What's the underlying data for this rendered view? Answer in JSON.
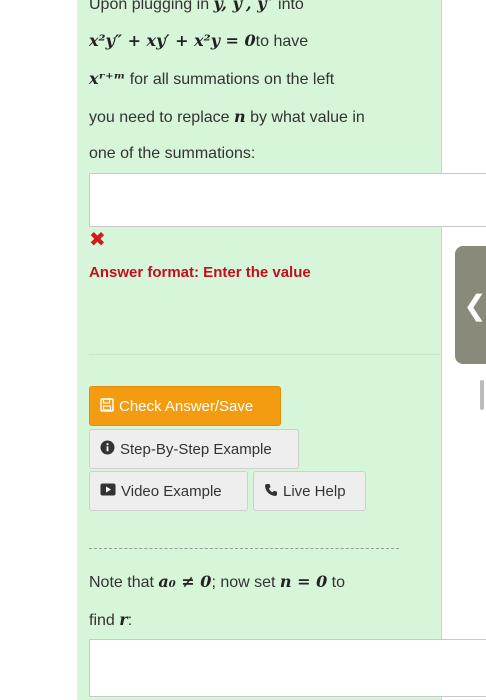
{
  "question": {
    "line1_prefix": "Upon plugging in ",
    "line1_math": "y, y′, y″",
    "line1_suffix": " into",
    "equation_math": "x²y″ + xy′ + x²y = 0",
    "equation_suffix": "to have",
    "power_math": "xʳ⁺ᵐ",
    "power_suffix": " for all summations on the left",
    "line4": "you need to replace ",
    "line4_math": "n",
    "line4_suffix": " by what value in",
    "line5": "one of the summations:"
  },
  "answer1": {
    "value": "",
    "status_icon": "cross-icon",
    "format_label": "Answer format: Enter the value"
  },
  "buttons": {
    "check_label": "Check Answer/Save",
    "check_icon": "save-icon",
    "step_label": "Step-By-Step Example",
    "step_icon": "info-circle-icon",
    "video_label": "Video Example",
    "video_icon": "play-icon",
    "help_label": "Live Help",
    "help_icon": "phone-icon"
  },
  "question2": {
    "prefix": "Note that ",
    "math1": "a₀ ≠ 0",
    "middle": "; now set ",
    "math2": "n = 0",
    "suffix": " to",
    "line2_prefix": "find ",
    "line2_math": "r",
    "line2_suffix": ":"
  },
  "answer2": {
    "value": ""
  },
  "side_tab": {
    "glyph": "❮"
  },
  "colors": {
    "panel_bg": "#d7f5d9",
    "error_red": "#c0101f",
    "accent_orange": "#f39c12"
  }
}
